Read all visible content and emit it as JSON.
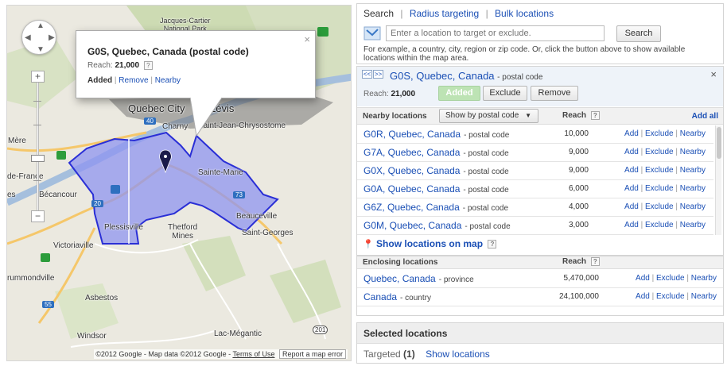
{
  "map": {
    "labels": {
      "jacques_cartier": "Jacques-Cartier\nNational Park",
      "quebec_city": "Quebec City",
      "levis": "Lévis",
      "charny": "Charny",
      "saint_jean": "Saint-Jean-Chrysostome",
      "mere": "Mère",
      "de_france": "de-France",
      "es": "es",
      "becancour": "Bécancour",
      "sainte_marie": "Sainte-Marie",
      "beauceville": "Beauceville",
      "saint_georges": "Saint-Georges",
      "plessisville": "Plessisville",
      "thetford_mines": "Thetford\nMines",
      "victoriaville": "Victoriaville",
      "drummondville": "rummondville",
      "asbestos": "Asbestos",
      "windsor": "Windsor",
      "lac_megantic": "Lac-Mégantic"
    },
    "shields": {
      "r40": "40",
      "r20": "20",
      "r73": "73",
      "r55": "55",
      "r201": "201"
    },
    "zoom": {
      "plus": "+",
      "minus": "−"
    },
    "infowindow": {
      "title": "G0S, Quebec, Canada (postal code)",
      "reach_label": "Reach:",
      "reach_value": "21,000",
      "help": "?",
      "added": "Added",
      "remove": "Remove",
      "nearby": "Nearby",
      "close": "×"
    },
    "footer": {
      "copyright": "©2012 Google - Map data ©2012 Google -",
      "terms": "Terms of Use",
      "report": "Report a map error"
    }
  },
  "tabs": {
    "search": "Search",
    "radius": "Radius targeting",
    "bulk": "Bulk locations",
    "sep": "|"
  },
  "search": {
    "placeholder": "Enter a location to target or exclude.",
    "button": "Search",
    "hint": "For example, a country, city, region or zip code. Or, click the button above to show available locations within the map area."
  },
  "selected_location": {
    "prev": "<<",
    "next": ">>",
    "name": "G0S, Quebec, Canada",
    "type": "- postal code",
    "reach_label": "Reach:",
    "reach_value": "21,000",
    "added_label": "Added",
    "exclude_label": "Exclude",
    "remove_label": "Remove",
    "close": "×"
  },
  "nearby": {
    "title": "Nearby locations",
    "dropdown": "Show by postal code",
    "reach_header": "Reach",
    "help": "?",
    "add_all": "Add all",
    "rows": [
      {
        "name": "G0R, Quebec, Canada",
        "type": "- postal code",
        "reach": "10,000"
      },
      {
        "name": "G7A, Quebec, Canada",
        "type": "- postal code",
        "reach": "9,000"
      },
      {
        "name": "G0X, Quebec, Canada",
        "type": "- postal code",
        "reach": "9,000"
      },
      {
        "name": "G0A, Quebec, Canada",
        "type": "- postal code",
        "reach": "6,000"
      },
      {
        "name": "G6Z, Quebec, Canada",
        "type": "- postal code",
        "reach": "4,000"
      },
      {
        "name": "G0M, Quebec, Canada",
        "type": "- postal code",
        "reach": "3,000"
      }
    ],
    "row_actions": {
      "add": "Add",
      "exclude": "Exclude",
      "nearby": "Nearby",
      "sep": "|"
    },
    "show_on_map": "Show locations on map"
  },
  "enclosing": {
    "title": "Enclosing locations",
    "reach_header": "Reach",
    "help": "?",
    "rows": [
      {
        "name": "Quebec, Canada",
        "type": "- province",
        "reach": "5,470,000"
      },
      {
        "name": "Canada",
        "type": "- country",
        "reach": "24,100,000"
      }
    ]
  },
  "selected_box": {
    "title": "Selected locations",
    "targeted_label": "Targeted",
    "targeted_count": "(1)",
    "show_locations": "Show locations"
  },
  "colors": {
    "link": "#1a4fb5",
    "polygon_fill": "#8f94f0",
    "polygon_stroke": "#2a2fd6",
    "added_green": "#bde3b4"
  }
}
